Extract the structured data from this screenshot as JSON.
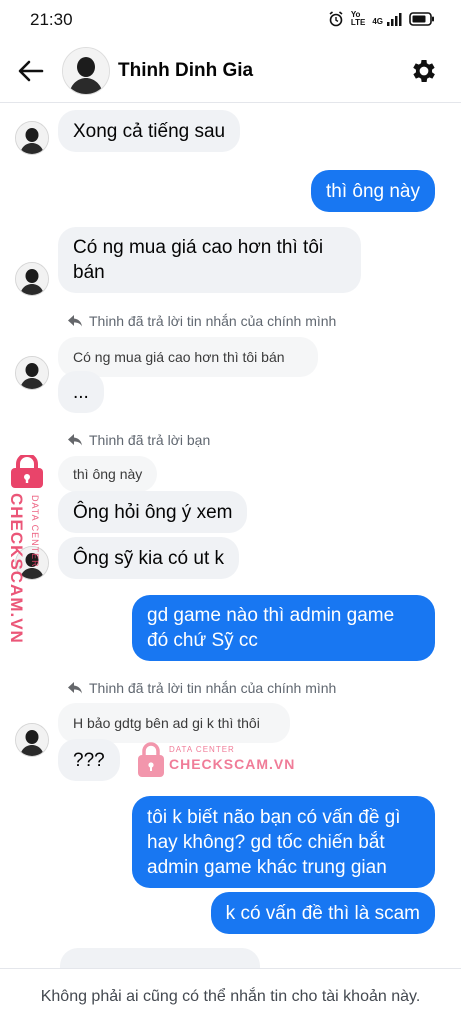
{
  "status_bar": {
    "time": "21:30",
    "network_top": "Yo",
    "network_bottom": "LTE",
    "network_type": "4G"
  },
  "header": {
    "contact_name": "Thinh Dinh Gia"
  },
  "messages": [
    {
      "text": "Xong cả tiếng sau"
    },
    {
      "text": "thì ông này"
    },
    {
      "text": "Có ng mua giá cao hơn thì tôi bán"
    },
    {
      "reply_label": "Thinh đã trả lời tin nhắn của chính mình",
      "quoted": "Có ng mua giá cao hơn thì tôi bán",
      "text": "..."
    },
    {
      "reply_label": "Thinh đã trả lời bạn",
      "quoted": "thì ông này",
      "text": "Ông hỏi ông ý xem"
    },
    {
      "text": "Ông sỹ kia có ut k"
    },
    {
      "text": "gd game nào thì admin game đó chứ Sỹ cc"
    },
    {
      "reply_label": "Thinh đã trả lời tin nhắn của chính mình",
      "quoted": "H bảo gdtg bên ad gi k thì thôi",
      "text": "???"
    },
    {
      "text": "tôi k biết não bạn có vấn đề gì hay không? gd tốc chiến bắt admin game khác trung gian"
    },
    {
      "text": "k có vấn đề thì là scam"
    }
  ],
  "watermark": {
    "brand": "CHECKSCAM.VN",
    "subtitle": "DATA CENTER"
  },
  "footer": {
    "notice": "Không phải ai cũng có thể nhắn tin cho tài khoản này."
  },
  "colors": {
    "outgoing_bubble": "#1877f2",
    "incoming_bubble": "#f0f2f5",
    "watermark": "#e9446a"
  }
}
